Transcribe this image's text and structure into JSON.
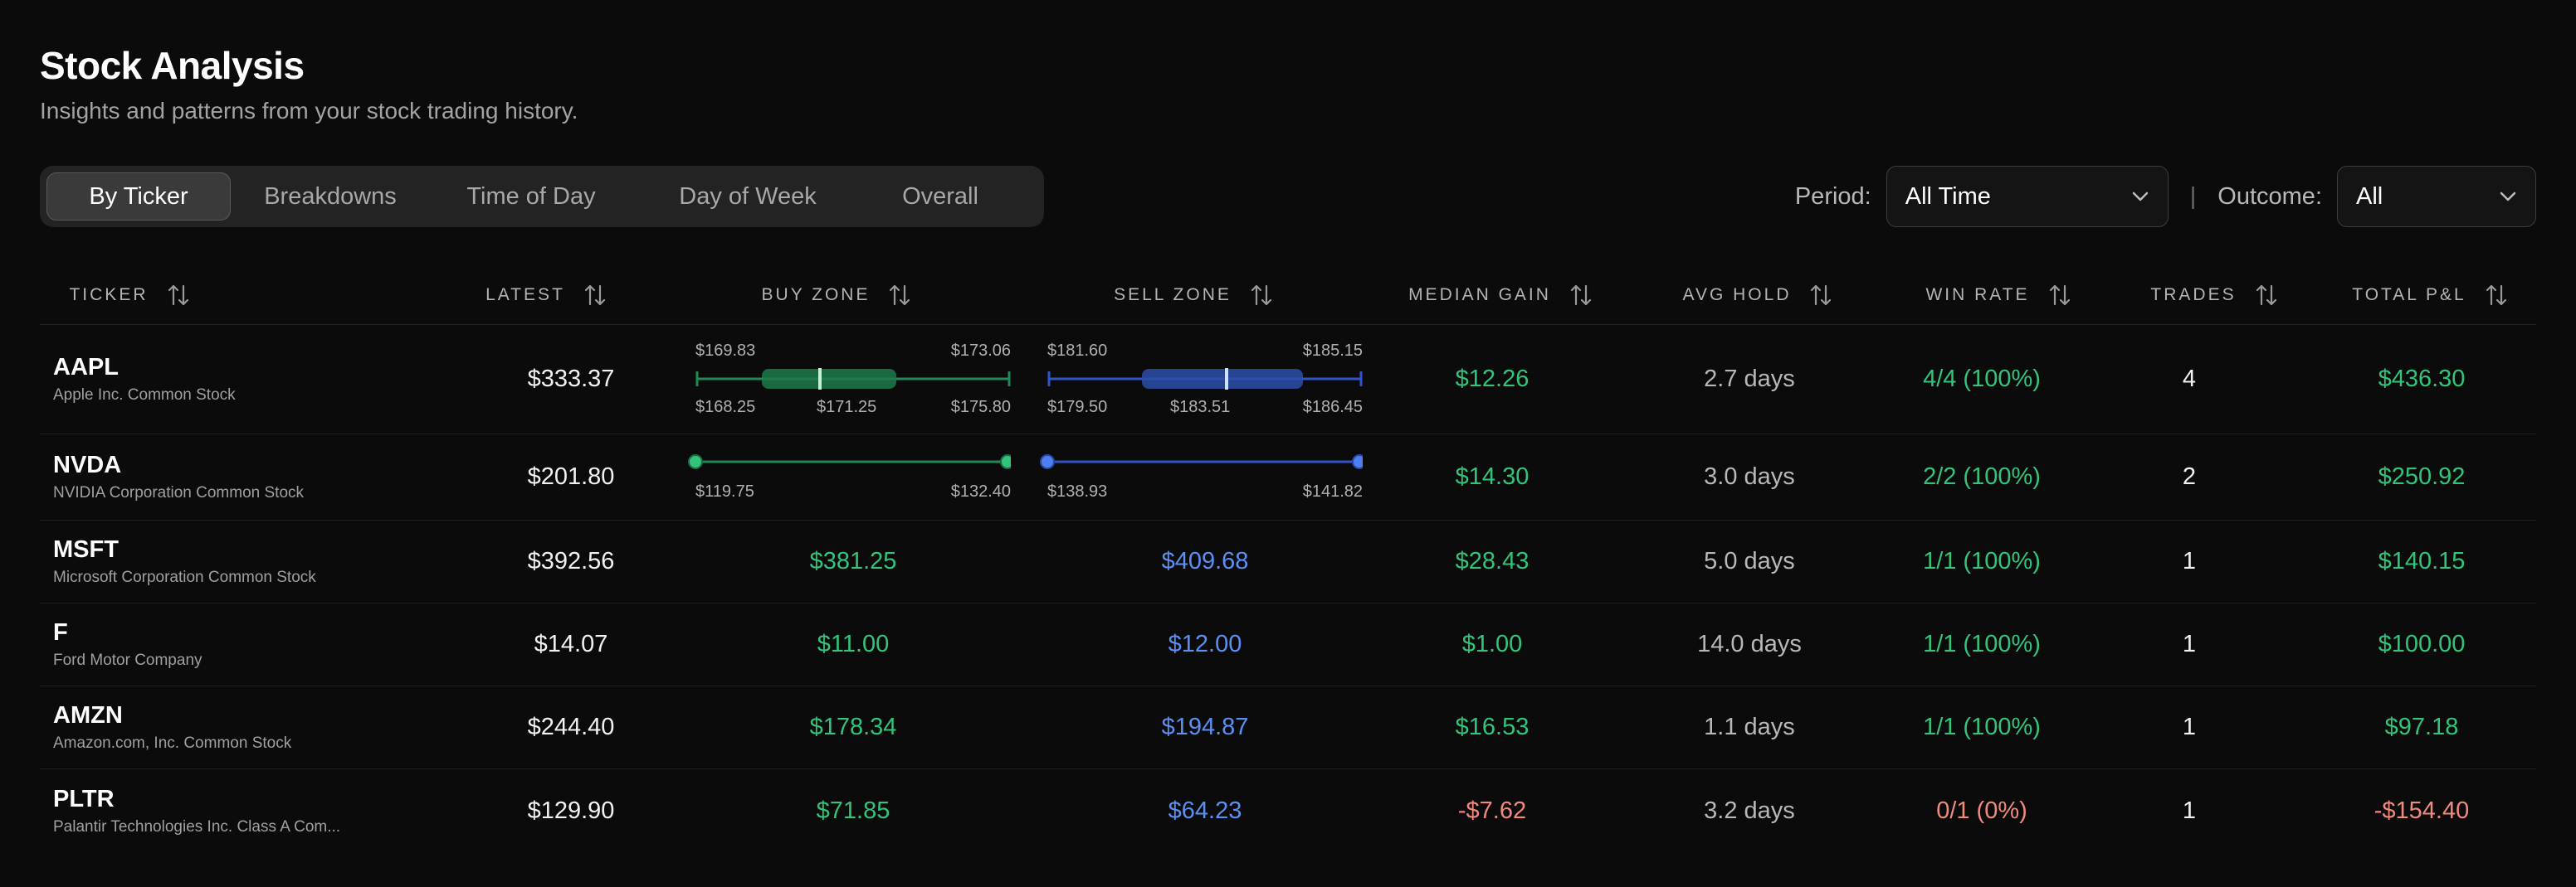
{
  "header": {
    "title": "Stock Analysis",
    "subtitle": "Insights and patterns from your stock trading history."
  },
  "tabs": [
    "By Ticker",
    "Breakdowns",
    "Time of Day",
    "Day of Week",
    "Overall"
  ],
  "active_tab": "By Ticker",
  "filters": {
    "period_label": "Period:",
    "period_value": "All Time",
    "separator": "|",
    "outcome_label": "Outcome:",
    "outcome_value": "All"
  },
  "columns": [
    "TICKER",
    "LATEST",
    "BUY ZONE",
    "SELL ZONE",
    "MEDIAN GAIN",
    "AVG HOLD",
    "WIN RATE",
    "TRADES",
    "TOTAL P&L"
  ],
  "rows": [
    {
      "ticker": "AAPL",
      "name": "Apple Inc. Common Stock",
      "latest": "$333.37",
      "buy": {
        "top_left": "$169.83",
        "top_right": "$173.06",
        "bottom_left": "$168.25",
        "median": "$171.25",
        "bottom_right": "$175.80"
      },
      "sell": {
        "top_left": "$181.60",
        "top_right": "$185.15",
        "bottom_left": "$179.50",
        "median": "$183.51",
        "bottom_right": "$186.45"
      },
      "median_gain": "$12.26",
      "avg_hold": "2.7 days",
      "win_rate": "4/4 (100%)",
      "trades": "4",
      "total_pl": "$436.30"
    },
    {
      "ticker": "NVDA",
      "name": "NVIDIA Corporation Common Stock",
      "latest": "$201.80",
      "buy": {
        "low": "$119.75",
        "high": "$132.40"
      },
      "sell": {
        "low": "$138.93",
        "high": "$141.82"
      },
      "median_gain": "$14.30",
      "avg_hold": "3.0 days",
      "win_rate": "2/2 (100%)",
      "trades": "2",
      "total_pl": "$250.92"
    },
    {
      "ticker": "MSFT",
      "name": "Microsoft Corporation Common Stock",
      "latest": "$392.56",
      "buy_value": "$381.25",
      "sell_value": "$409.68",
      "median_gain": "$28.43",
      "avg_hold": "5.0 days",
      "win_rate": "1/1 (100%)",
      "trades": "1",
      "total_pl": "$140.15"
    },
    {
      "ticker": "F",
      "name": "Ford Motor Company",
      "latest": "$14.07",
      "buy_value": "$11.00",
      "sell_value": "$12.00",
      "median_gain": "$1.00",
      "avg_hold": "14.0 days",
      "win_rate": "1/1 (100%)",
      "trades": "1",
      "total_pl": "$100.00"
    },
    {
      "ticker": "AMZN",
      "name": "Amazon.com, Inc. Common Stock",
      "latest": "$244.40",
      "buy_value": "$178.34",
      "sell_value": "$194.87",
      "median_gain": "$16.53",
      "avg_hold": "1.1 days",
      "win_rate": "1/1 (100%)",
      "trades": "1",
      "total_pl": "$97.18"
    },
    {
      "ticker": "PLTR",
      "name": "Palantir Technologies Inc. Class A Com...",
      "latest": "$129.90",
      "buy_value": "$71.85",
      "sell_value": "$64.23",
      "median_gain": "-$7.62",
      "avg_hold": "3.2 days",
      "win_rate": "0/1 (0%)",
      "trades": "1",
      "total_pl": "-$154.40"
    }
  ],
  "colors": {
    "positive": "#33c37a",
    "negative": "#f08a7e",
    "sell": "#5b8ff2",
    "background": "#0b0b0b"
  },
  "icons": {
    "sort": "sort-arrows-icon",
    "dropdown": "chevron-down-icon"
  }
}
